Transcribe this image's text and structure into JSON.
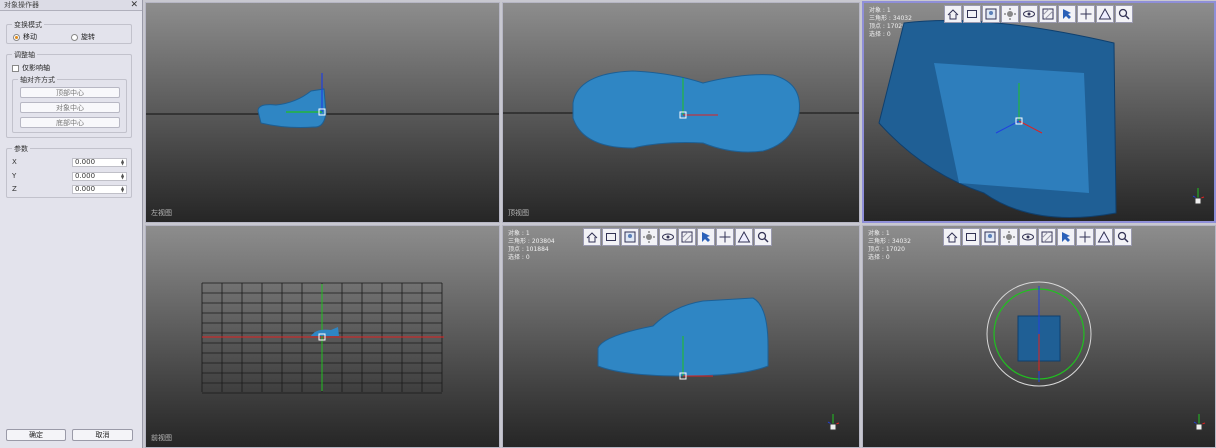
{
  "panel": {
    "title": "对象操作器",
    "close": "✕",
    "transform_mode": {
      "title": "变换模式",
      "options": [
        "移动",
        "旋转"
      ],
      "selected": "移动"
    },
    "adjust_axis": {
      "title": "调整轴",
      "checkbox": "仅影响轴",
      "align_title": "轴对齐方式",
      "buttons": [
        "顶部中心",
        "对象中心",
        "底部中心"
      ]
    },
    "params": {
      "title": "参数",
      "rows": [
        {
          "label": "X",
          "value": "0.000"
        },
        {
          "label": "Y",
          "value": "0.000"
        },
        {
          "label": "Z",
          "value": "0.000"
        }
      ]
    },
    "ok": "确定",
    "cancel": "取消"
  },
  "viewports": {
    "front": {
      "label": "左视图"
    },
    "top": {
      "label": "顶视图"
    },
    "grid": {
      "label": "前视图"
    },
    "perspective_tr": {
      "stats": [
        "对象 : 1",
        "三角形 : 34032",
        "顶点 : 17020",
        "选择 : 0"
      ]
    },
    "perspective_bm": {
      "stats": [
        "对象 : 1",
        "三角形 : 203804",
        "顶点 : 101884",
        "选择 : 0"
      ]
    },
    "perspective_br": {
      "stats": [
        "对象 : 1",
        "三角形 : 34032",
        "顶点 : 17020",
        "选择 : 0"
      ]
    }
  },
  "toolbar_icons": [
    "home-icon",
    "frame-icon",
    "material-icon",
    "light-icon",
    "eye-icon",
    "texture-icon",
    "select-cursor-icon",
    "move-arrows-icon",
    "mesh-triangle-icon",
    "zoom-search-icon"
  ],
  "colors": {
    "accent": "#e08a18",
    "axis_x": "#e02020",
    "axis_y": "#20c020",
    "axis_z": "#2040e0",
    "model": "#2f86c4"
  }
}
